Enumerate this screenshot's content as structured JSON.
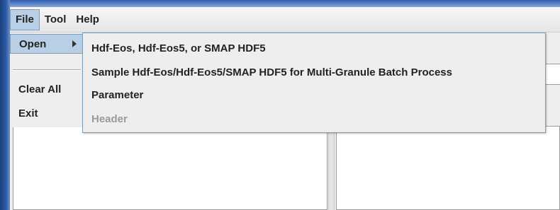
{
  "menubar": {
    "items": [
      {
        "label": "File"
      },
      {
        "label": "Tool"
      },
      {
        "label": "Help"
      }
    ]
  },
  "file_menu": {
    "open_label": "Open",
    "clear_all_label": "Clear All",
    "exit_label": "Exit"
  },
  "open_submenu": {
    "items": [
      {
        "label": "Hdf-Eos, Hdf-Eos5, or SMAP HDF5",
        "enabled": true
      },
      {
        "label": "Sample Hdf-Eos/Hdf-Eos5/SMAP HDF5 for Multi-Granule Batch Process",
        "enabled": true
      },
      {
        "label": "Parameter",
        "enabled": true
      },
      {
        "label": "Header",
        "enabled": false
      }
    ]
  },
  "colors": {
    "highlight": "#b8cfe5",
    "highlight_border": "#7f9db9",
    "disabled_text": "#9a9a9a"
  }
}
